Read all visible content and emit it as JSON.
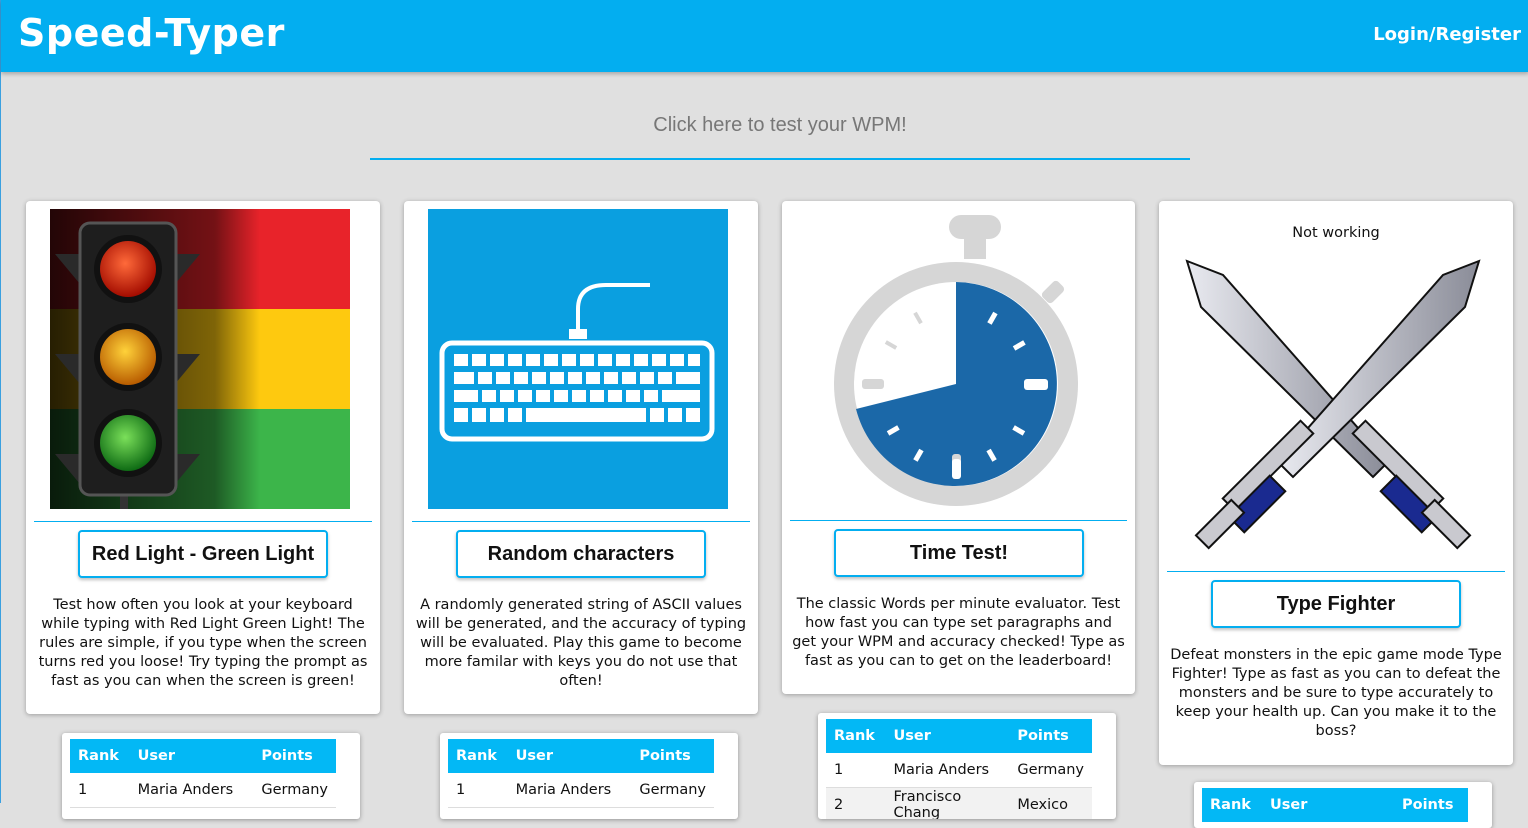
{
  "header": {
    "brand": "Speed-Typer",
    "login": "Login/Register"
  },
  "wpm_prompt": "Click here to test your WPM!",
  "cards": [
    {
      "button": "Red Light - Green Light",
      "description": "Test how often you look at your keyboard while typing with Red Light Green Light! The rules are simple, if you type when the screen turns red you loose! Try typing the prompt as fast as you can when the screen is green!"
    },
    {
      "button": "Random characters",
      "description": "A randomly generated string of ASCII values will be generated, and the accuracy of typing will be evaluated. Play this game to become more familar with keys you do not use that often!"
    },
    {
      "button": "Time Test!",
      "description": "The classic Words per minute evaluator. Test how fast you can type set paragraphs and get your WPM and accuracy checked! Type as fast as you can to get on the leaderboard!"
    },
    {
      "note": "Not working",
      "button": "Type Fighter",
      "description": "Defeat monsters in the epic game mode Type Fighter! Type as fast as you can to defeat the monsters and be sure to type accurately to keep your health up. Can you make it to the boss?"
    }
  ],
  "leaderboard": {
    "headers": {
      "rank": "Rank",
      "user": "User",
      "points": "Points"
    },
    "row1": {
      "rank": "1",
      "user": "Maria Anders",
      "points": "Germany"
    },
    "row2_partial": {
      "rank": "2",
      "user": "Francisco Chang",
      "points": "Mexico"
    }
  },
  "colors": {
    "accent": "#03aef0",
    "background": "#e0e0e0"
  }
}
